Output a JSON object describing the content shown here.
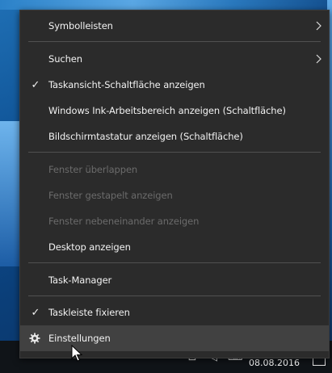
{
  "context_menu": {
    "items": [
      {
        "label": "Symbolleisten",
        "submenu": true
      },
      {
        "label": "Suchen",
        "submenu": true
      },
      {
        "label": "Taskansicht-Schaltfläche anzeigen",
        "checked": true
      },
      {
        "label": "Windows Ink-Arbeitsbereich anzeigen (Schaltfläche)"
      },
      {
        "label": "Bildschirmtastatur anzeigen (Schaltfläche)"
      },
      {
        "label": "Fenster überlappen",
        "disabled": true
      },
      {
        "label": "Fenster gestapelt anzeigen",
        "disabled": true
      },
      {
        "label": "Fenster nebeneinander anzeigen",
        "disabled": true
      },
      {
        "label": "Desktop anzeigen"
      },
      {
        "label": "Task-Manager"
      },
      {
        "label": "Taskleiste fixieren",
        "checked": true
      },
      {
        "label": "Einstellungen",
        "icon": "gear-icon",
        "highlighted": true
      }
    ]
  },
  "taskbar": {
    "date": "08.08.2016",
    "tray_icons": [
      "chevron-up-icon",
      "network-icon",
      "volume-icon",
      "keyboard-icon"
    ]
  },
  "colors": {
    "menu_background": "#2b2b2b",
    "menu_text": "#f2f2f2",
    "disabled_text": "#6b6b6b",
    "highlight": "#414141",
    "taskbar": "#101418"
  }
}
